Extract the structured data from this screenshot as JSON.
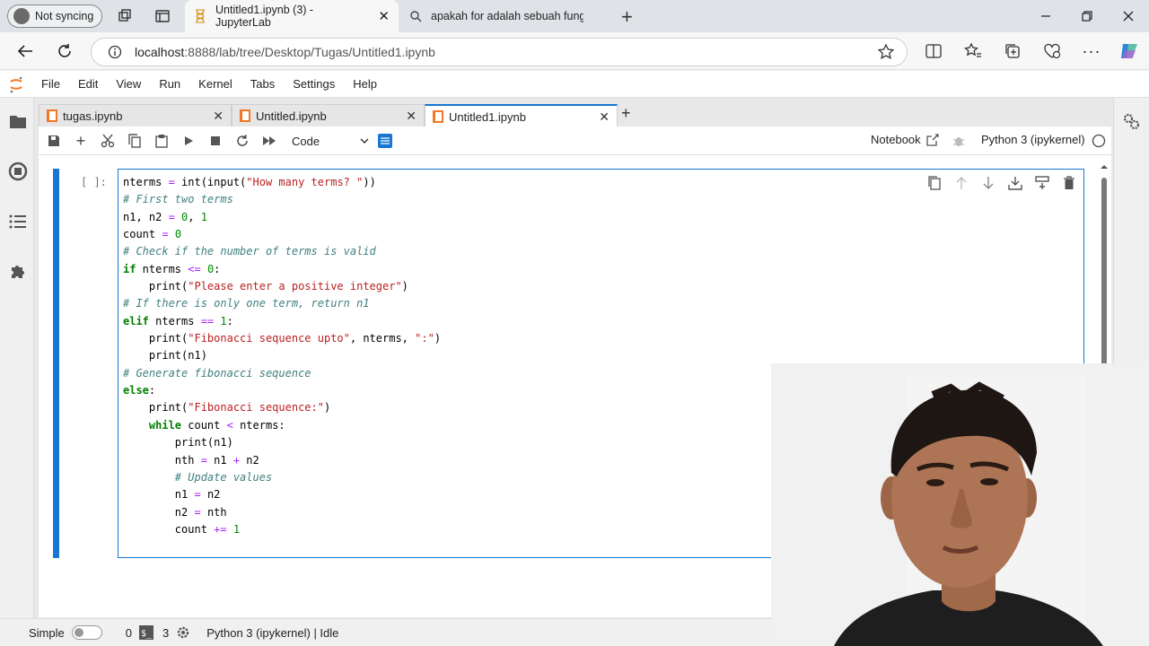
{
  "browser": {
    "profile_label": "Not syncing",
    "tabs": [
      {
        "title": "Untitled1.ipynb (3) - JupyterLab"
      },
      {
        "title": "apakah for adalah sebuah fungsi?"
      }
    ],
    "url_host": "localhost",
    "url_rest": ":8888/lab/tree/Desktop/Tugas/Untitled1.ipynb"
  },
  "jupyter": {
    "menu": [
      "File",
      "Edit",
      "View",
      "Run",
      "Kernel",
      "Tabs",
      "Settings",
      "Help"
    ],
    "notebook_tabs": [
      {
        "label": "tugas.ipynb"
      },
      {
        "label": "Untitled.ipynb"
      },
      {
        "label": "Untitled1.ipynb"
      }
    ],
    "cell_type": "Code",
    "notebook_label": "Notebook",
    "kernel_label": "Python 3 (ipykernel)",
    "prompt": "[ ]:",
    "status": {
      "mode": "Simple",
      "count_a": "0",
      "count_b": "3",
      "kernel_status": "Python 3 (ipykernel) | Idle"
    }
  },
  "code_lines": [
    "nterms = int(input(\"How many terms? \"))",
    "# First two terms",
    "n1, n2 = 0, 1",
    "count = 0",
    "# Check if the number of terms is valid",
    "if nterms <= 0:",
    "    print(\"Please enter a positive integer\")",
    "# If there is only one term, return n1",
    "elif nterms == 1:",
    "    print(\"Fibonacci sequence upto\", nterms, \":\")",
    "    print(n1)",
    "# Generate fibonacci sequence",
    "else:",
    "    print(\"Fibonacci sequence:\")",
    "    while count < nterms:",
    "        print(n1)",
    "        nth = n1 + n2",
    "        # Update values",
    "        n1 = n2",
    "        n2 = nth",
    "        count += 1"
  ],
  "colors": {
    "accent": "#1976d2",
    "comment": "#408080",
    "keyword": "#008000",
    "string": "#ba2121",
    "orange_tab_icon": "#f37726"
  }
}
